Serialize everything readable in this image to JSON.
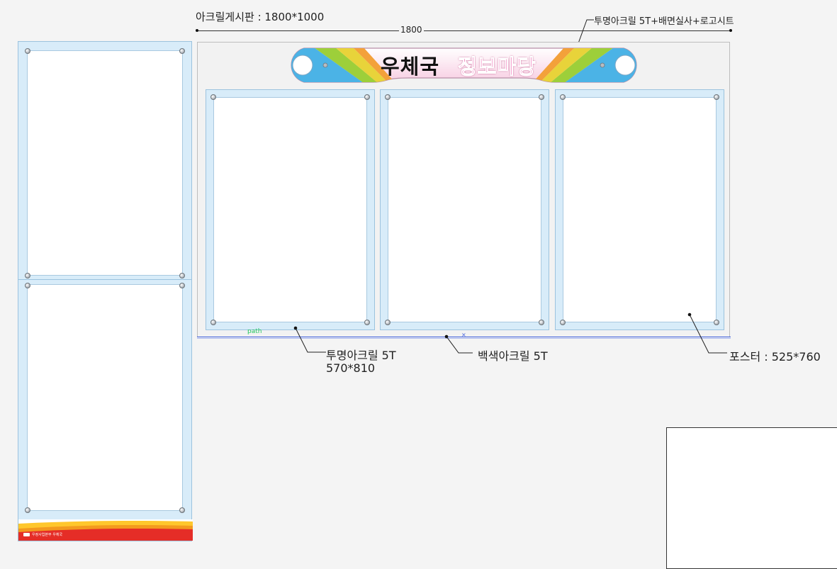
{
  "title": "아크릴게시판 : 1800*1000",
  "dimension_label": "1800",
  "annotations": {
    "top_right": "투명아크릴 5T+배면실사+로고시트",
    "clear_acrylic_label": "투명아크릴 5T",
    "clear_acrylic_size": "570*810",
    "white_acrylic": "백색아크릴 5T",
    "poster": "포스터 : 525*760",
    "path_tag": "path"
  },
  "header_sign": {
    "word1": "우체국",
    "word2": "정보마당"
  },
  "stand_logo": "우정사업본부 우체국",
  "colors": {
    "acrylic_blue": "#d8ecf9",
    "header_pink": "#e8178a",
    "stripe_red": "#e52d27",
    "stripe_orange": "#f39a1e",
    "stripe_yellow": "#ffc72c",
    "guide_blue": "#3b5bdb",
    "path_green": "#22c55e"
  }
}
